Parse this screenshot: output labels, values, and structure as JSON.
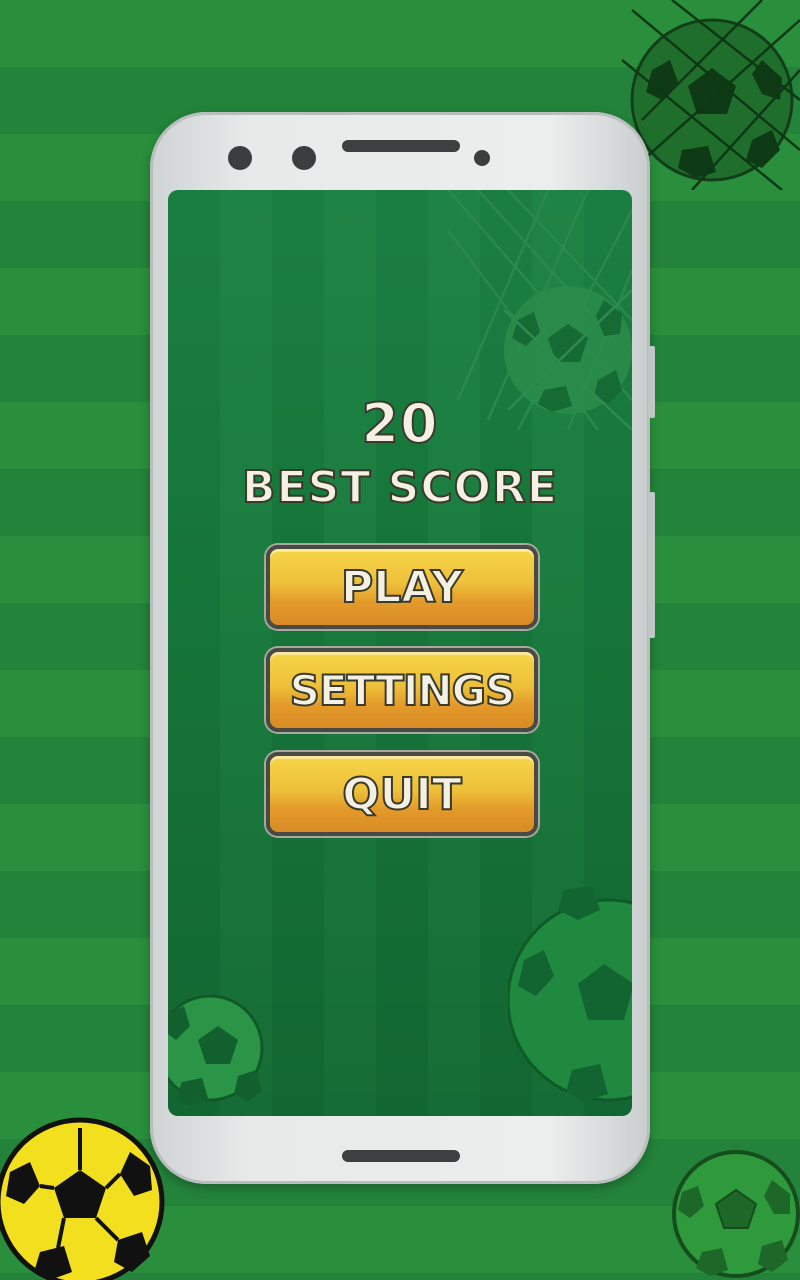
{
  "score": {
    "value": "20",
    "label": "BEST SCORE"
  },
  "menu": {
    "play_label": "PLAY",
    "settings_label": "SETTINGS",
    "quit_label": "QUIT"
  },
  "colors": {
    "background_green": "#2a8f3c",
    "screen_green": "#16763a",
    "button_yellow": "#eec03a",
    "button_orange": "#e39a2a",
    "text_cream": "#f4f1e4",
    "ball_yellow": "#f2e01e"
  },
  "icons": [
    "soccer-ball-icon",
    "goal-net-icon"
  ]
}
